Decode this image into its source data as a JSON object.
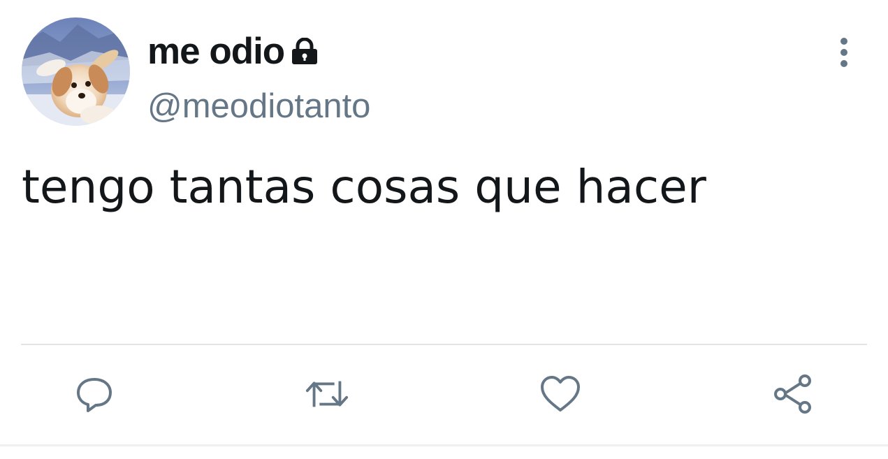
{
  "tweet": {
    "display_name": "me odio",
    "handle": "@meodiotanto",
    "text": "tengo tantas cosas que hacer",
    "protected_icon": "lock-icon",
    "avatar": "puppy-avatar"
  },
  "header": {
    "menu_icon": "more-vertical-icon"
  },
  "actions": [
    {
      "name": "reply",
      "icon": "reply-icon"
    },
    {
      "name": "retweet",
      "icon": "retweet-icon"
    },
    {
      "name": "like",
      "icon": "heart-icon"
    },
    {
      "name": "share",
      "icon": "share-icon"
    }
  ],
  "colors": {
    "text_primary": "#14171a",
    "text_secondary": "#657786",
    "icon": "#657786",
    "divider": "#e1e4e7",
    "background": "#ffffff"
  }
}
